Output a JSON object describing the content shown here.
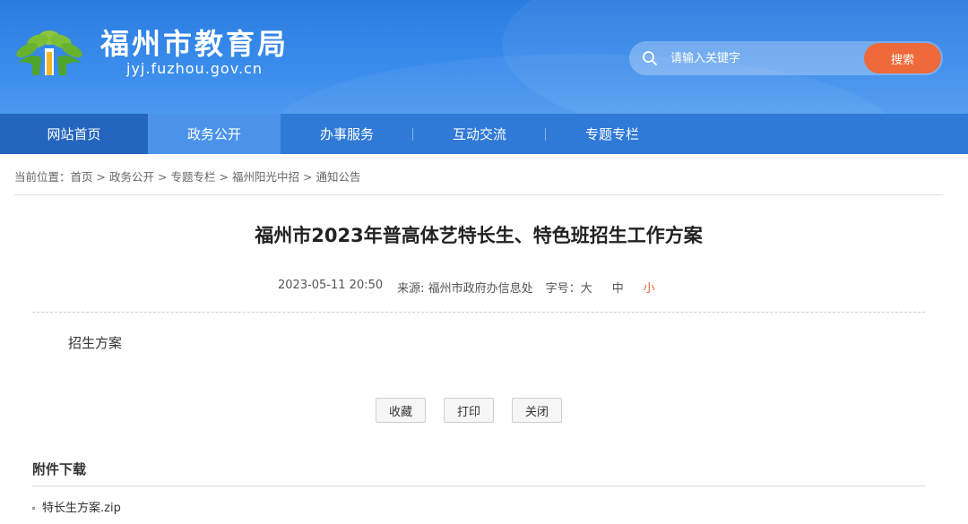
{
  "header": {
    "title": "福州市教育局",
    "domain": "jyj.fuzhou.gov.cn",
    "logo_icon": "fuzhou-education-logo"
  },
  "search": {
    "placeholder": "请输入关键字",
    "button_label": "搜索",
    "icon": "search-icon"
  },
  "nav": {
    "items": [
      {
        "label": "网站首页"
      },
      {
        "label": "政务公开"
      },
      {
        "label": "办事服务"
      },
      {
        "label": "互动交流"
      },
      {
        "label": "专题专栏"
      }
    ]
  },
  "breadcrumb": {
    "prefix": "当前位置：",
    "items": [
      "首页",
      "政务公开",
      "专题专栏",
      "福州阳光中招",
      "通知公告"
    ],
    "separator": ">"
  },
  "article": {
    "title": "福州市2023年普高体艺特长生、特色班招生工作方案",
    "datetime": "2023-05-11 20:50",
    "source": "来源: 福州市政府办信息处",
    "font_size_label": "字号：",
    "font_sizes": [
      "大",
      "中",
      "小"
    ],
    "content_heading": "招生方案"
  },
  "actions": {
    "favorite": "收藏",
    "print": "打印",
    "close": "关闭"
  },
  "attachments": {
    "heading": "附件下载",
    "items": [
      "特长生方案.zip"
    ]
  },
  "colors": {
    "header_blue": "#3a8cec",
    "nav_blue": "#2f7ad6",
    "nav_active": "#4b93ea",
    "search_button": "#ef6a3a",
    "size_small_accent": "#e2623a"
  }
}
